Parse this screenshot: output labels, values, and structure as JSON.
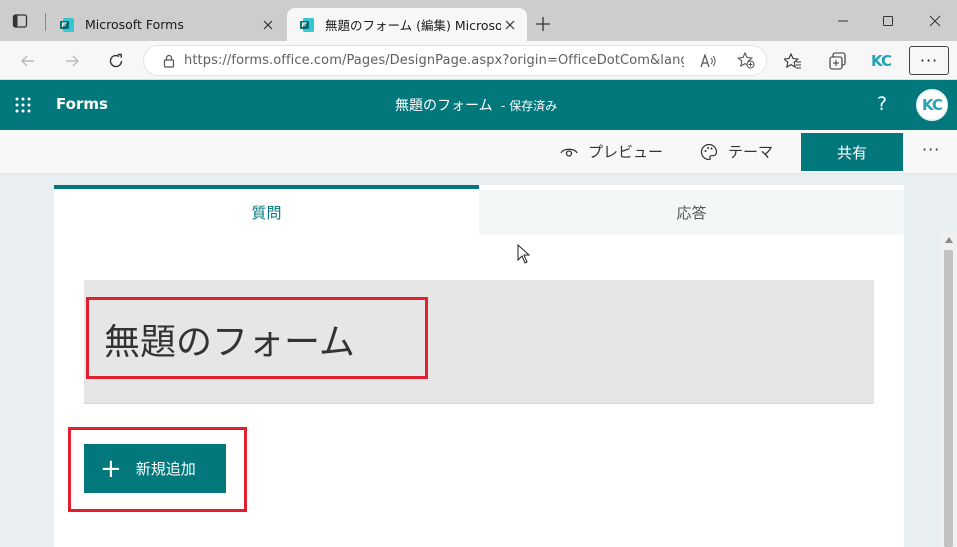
{
  "browser": {
    "tabs": [
      {
        "title": "Microsoft Forms",
        "active": false
      },
      {
        "title": "無題のフォーム (編集) Microsoft Fo",
        "active": true
      }
    ],
    "url": "https://forms.office.com/Pages/DesignPage.aspx?origin=OfficeDotCom&lang=...",
    "profile_initials": "KC",
    "menu_label": "···",
    "new_tab_label": "+"
  },
  "app": {
    "name": "Forms",
    "document_title": "無題のフォーム",
    "document_status": "- 保存済み",
    "help_label": "?",
    "avatar_initials": "KC"
  },
  "commandbar": {
    "preview_label": "プレビュー",
    "theme_label": "テーマ",
    "share_label": "共有",
    "more_label": "···"
  },
  "content": {
    "tabs": [
      {
        "label": "質問",
        "active": true
      },
      {
        "label": "応答",
        "active": false
      }
    ],
    "form_title": "無題のフォーム",
    "add_new_label": "新規追加",
    "add_new_icon": "+"
  },
  "colors": {
    "brand": "#03787c",
    "highlight": "#e0202e"
  }
}
